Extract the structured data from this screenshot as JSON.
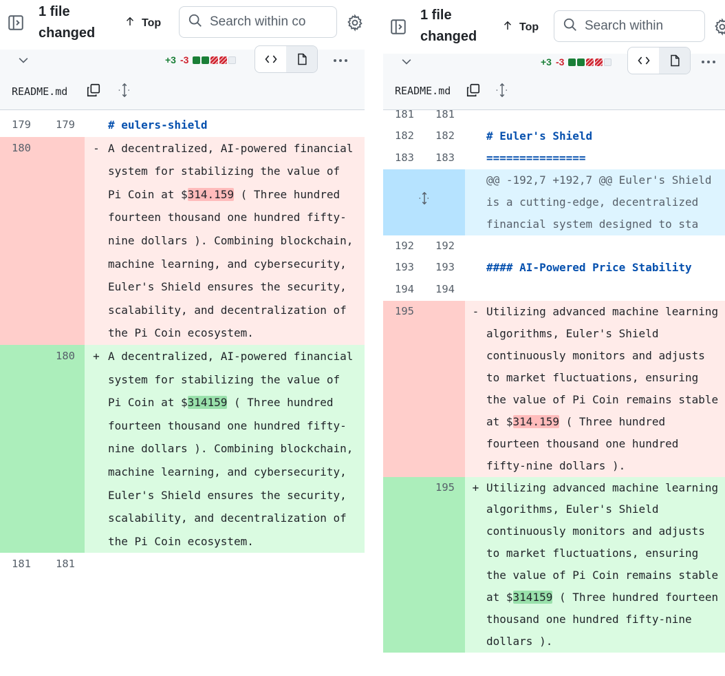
{
  "toolbar": {
    "file_count": "1 file changed",
    "top_label": "Top",
    "search_placeholder": "Search within code"
  },
  "file": {
    "name": "README.md",
    "additions": "+3",
    "deletions": "-3",
    "diffstat_blocks": [
      "added",
      "added",
      "deleted",
      "deleted",
      "neutral"
    ]
  },
  "left_diff": {
    "rows": [
      {
        "type": "head",
        "old": "179",
        "new": "179",
        "sign": "",
        "text": "# eulers-shield"
      },
      {
        "type": "del",
        "old": "180",
        "new": "",
        "sign": "-",
        "before": "A decentralized, AI-powered financial system for stabilizing the value of Pi Coin at $",
        "mark": "314.159",
        "after": " ( Three hundred fourteen thousand one hundred fifty-nine dollars ). Combining blockchain, machine learning, and cybersecurity, Euler's Shield ensures the security, scalability, and decentralization of the Pi Coin ecosystem."
      },
      {
        "type": "add",
        "old": "",
        "new": "180",
        "sign": "+",
        "before": "A decentralized, AI-powered financial system for stabilizing the value of Pi Coin at $",
        "mark": "314159",
        "after": " ( Three hundred fourteen thousand one hundred fifty-nine dollars ). Combining blockchain, machine learning, and cybersecurity, Euler's Shield ensures the security, scalability, and decentralization of the Pi Coin ecosystem."
      },
      {
        "type": "ctx",
        "old": "181",
        "new": "181",
        "sign": "",
        "text": ""
      }
    ]
  },
  "right_diff": {
    "rows": [
      {
        "type": "ctx",
        "old": "181",
        "new": "181",
        "sign": "",
        "text": ""
      },
      {
        "type": "ctx",
        "old": "182",
        "new": "182",
        "sign": "",
        "text": "# Euler's Shield",
        "heading": true
      },
      {
        "type": "ctx",
        "old": "183",
        "new": "183",
        "sign": "",
        "text": "===============",
        "heading": true
      },
      {
        "type": "hunk",
        "text": "@@ -192,7 +192,7 @@ Euler's Shield is a cutting-edge, decentralized financial system designed to sta"
      },
      {
        "type": "ctx",
        "old": "192",
        "new": "192",
        "sign": "",
        "text": ""
      },
      {
        "type": "ctx",
        "old": "193",
        "new": "193",
        "sign": "",
        "text": "#### AI-Powered Price Stability",
        "heading": true
      },
      {
        "type": "ctx",
        "old": "194",
        "new": "194",
        "sign": "",
        "text": ""
      },
      {
        "type": "del",
        "old": "195",
        "new": "",
        "sign": "-",
        "before": "Utilizing advanced machine learning algorithms, Euler's Shield continuously monitors and adjusts to market fluctuations, ensuring the value of Pi Coin remains stable at $",
        "mark": "314.159",
        "after": " ( Three hundred fourteen thousand one hundred fifty-nine dollars )."
      },
      {
        "type": "add",
        "old": "",
        "new": "195",
        "sign": "+",
        "before": "Utilizing advanced machine learning algorithms, Euler's Shield continuously monitors and adjusts to market fluctuations, ensuring the value of Pi Coin remains stable at $",
        "mark": "314159",
        "after": " ( Three hundred fourteen thousand one hundred fifty-nine dollars )."
      }
    ]
  }
}
